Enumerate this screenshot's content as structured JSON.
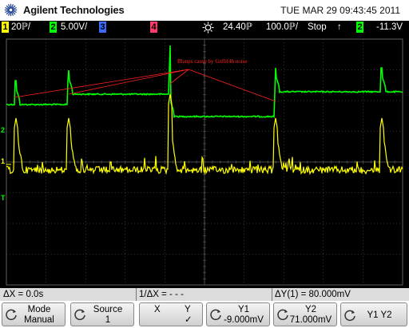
{
  "header": {
    "brand": "Agilent Technologies",
    "datetime": "TUE MAR 29 09:43:45 2011"
  },
  "status_bar": {
    "ch1_num": "1",
    "ch1_scale": "20ℙ/",
    "ch2_num": "2",
    "ch2_scale": "5.00V/",
    "ch3_num": "3",
    "ch4_num": "4",
    "time_delay": "24.40ℙ",
    "timebase": "100.0ℙ/",
    "run_state": "Stop",
    "trig_slope": "↑",
    "trig_source": "2",
    "trig_level": "-11.3V"
  },
  "plot": {
    "annotation": "Blanps cause by Gnfbf4h noise",
    "markers": {
      "ch2": "2",
      "ch1": "1",
      "trigger": "T"
    }
  },
  "measurements": {
    "dx": "ΔX = 0.0s",
    "inv_dx": "1/ΔX = - - -",
    "dy": "ΔY(1) = 80.000mV"
  },
  "softkeys": [
    {
      "line1": "Mode",
      "line2": "Manual",
      "rotary": true
    },
    {
      "line1": "Source",
      "line2": "1",
      "rotary": true
    },
    {
      "line1": "X",
      "line2": "",
      "extra1": "Y",
      "extra2": "✓",
      "rotary": false
    },
    {
      "line1": "Y1",
      "line2": "-9.000mV",
      "rotary": true
    },
    {
      "line1": "Y2",
      "line2": "71.000mV",
      "rotary": true
    },
    {
      "line1": "Y1 Y2",
      "line2": "",
      "rotary": true
    }
  ],
  "colors": {
    "ch1": "#ffff00",
    "ch2": "#00ff00",
    "ch3": "#3a6bff",
    "ch4": "#ff3b6b",
    "annotation": "#ff2020",
    "grid": "#606060"
  }
}
